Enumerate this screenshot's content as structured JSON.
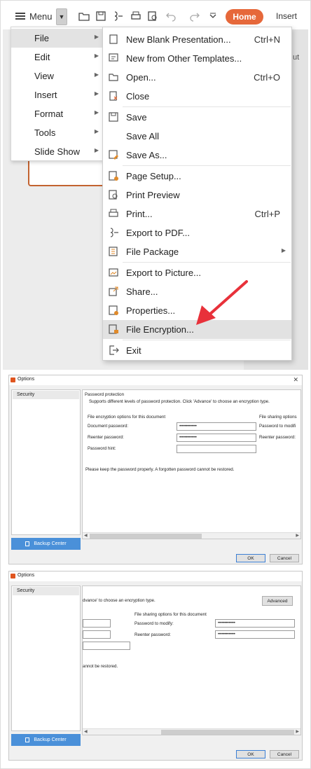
{
  "toolbar": {
    "menu_label": "Menu",
    "home_label": "Home",
    "insert_label": "Insert",
    "accent": "#e6683a",
    "right_edge_text": "ut"
  },
  "main_menu": {
    "items": [
      {
        "label": "File"
      },
      {
        "label": "Edit"
      },
      {
        "label": "View"
      },
      {
        "label": "Insert"
      },
      {
        "label": "Format"
      },
      {
        "label": "Tools"
      },
      {
        "label": "Slide Show"
      }
    ]
  },
  "file_menu": {
    "items": [
      {
        "label": "New Blank Presentation...",
        "shortcut": "Ctrl+N",
        "icon": "new-doc-icon"
      },
      {
        "label": "New from Other Templates...",
        "shortcut": "",
        "icon": "template-icon"
      },
      {
        "label": "Open...",
        "shortcut": "Ctrl+O",
        "icon": "folder-open-icon"
      },
      {
        "label": "Close",
        "shortcut": "",
        "icon": "close-doc-icon"
      },
      {
        "label": "Save",
        "shortcut": "",
        "icon": "save-icon"
      },
      {
        "label": "Save All",
        "shortcut": "",
        "icon": ""
      },
      {
        "label": "Save As...",
        "shortcut": "",
        "icon": "save-as-icon"
      },
      {
        "label": "Page Setup...",
        "shortcut": "",
        "icon": "page-setup-icon"
      },
      {
        "label": "Print Preview",
        "shortcut": "",
        "icon": "print-preview-icon"
      },
      {
        "label": "Print...",
        "shortcut": "Ctrl+P",
        "icon": "print-icon"
      },
      {
        "label": "Export to PDF...",
        "shortcut": "",
        "icon": "export-pdf-icon"
      },
      {
        "label": "File Package",
        "shortcut": "",
        "icon": "package-icon"
      },
      {
        "label": "Export to Picture...",
        "shortcut": "",
        "icon": "picture-icon"
      },
      {
        "label": "Share...",
        "shortcut": "",
        "icon": "share-icon"
      },
      {
        "label": "Properties...",
        "shortcut": "",
        "icon": "properties-icon"
      },
      {
        "label": "File Encryption...",
        "shortcut": "",
        "icon": "encryption-icon"
      },
      {
        "label": "Exit",
        "shortcut": "",
        "icon": "exit-icon"
      }
    ]
  },
  "options_dialog": {
    "title": "Options",
    "nav_item": "Security",
    "backup_label": "Backup Center",
    "section_title": "Password protection",
    "description": "Supports different levels of password protection. Click 'Advance' to choose an encryption type.",
    "description_tail": "dvance' to choose an encryption type.",
    "encryption_header": "File encryption options for this document",
    "doc_password_label": "Document password:",
    "reenter_label": "Reenter password:",
    "hint_label": "Password hint:",
    "masked": "•••••••••••••",
    "sharing_header": "File sharing options for this document",
    "sharing_header_cut": "File sharing options",
    "modify_label": "Password to modify:",
    "modify_label_cut": "Password to modifi",
    "reenter_cut": "Reenter password:",
    "warning": "Please keep the password properly. A forgotten password cannot be restored.",
    "warning_tail": "annot be restored.",
    "advanced_label": "Advanced",
    "ok_label": "OK",
    "cancel_label": "Cancel",
    "backup_color": "#4a90d9"
  }
}
